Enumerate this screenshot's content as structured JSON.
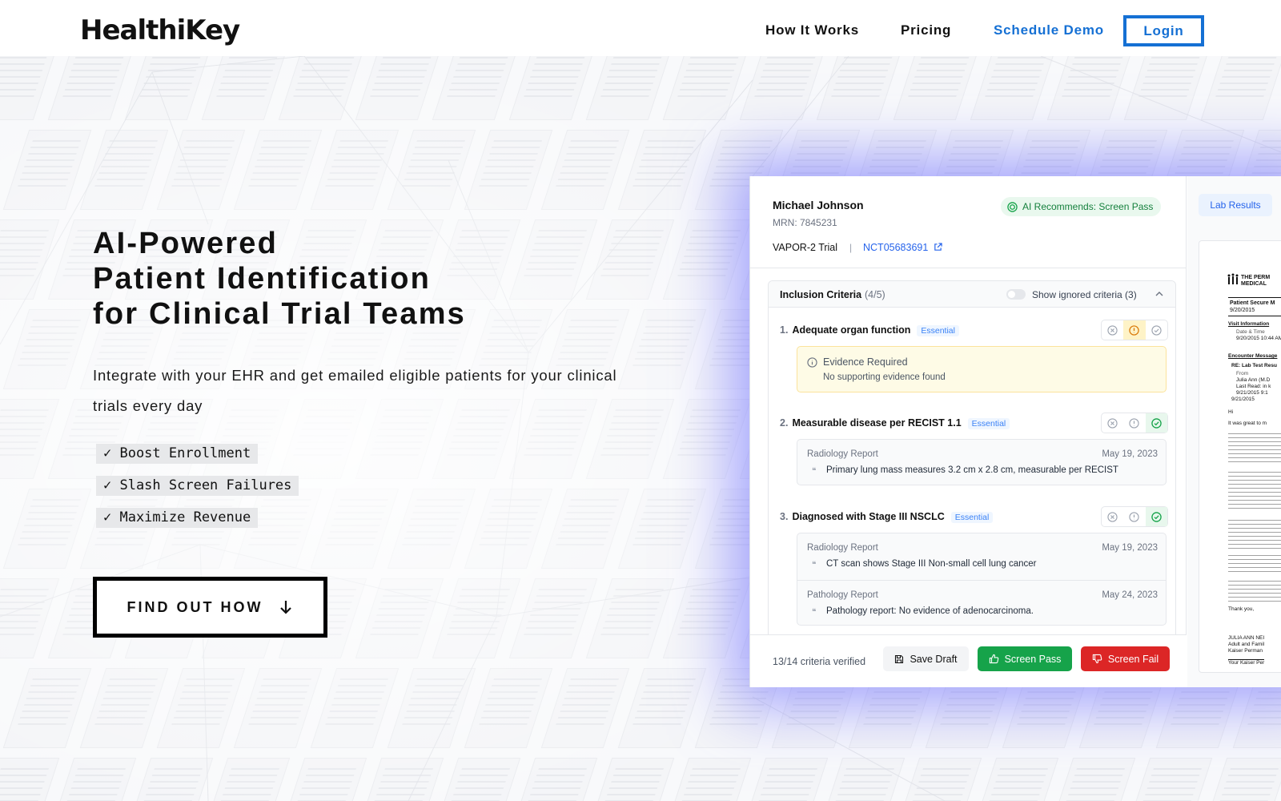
{
  "brand": {
    "logo": "HealthiKey"
  },
  "nav": {
    "how_it_works": "How It Works",
    "pricing": "Pricing",
    "schedule_demo": "Schedule Demo",
    "login": "Login"
  },
  "hero": {
    "title_lines": [
      "AI-Powered",
      "Patient Identification",
      "for Clinical Trial Teams"
    ],
    "subtitle": "Integrate with your EHR and get emailed eligible patients for your clinical trials every day",
    "checks": [
      "✓ Boost Enrollment",
      "✓ Slash Screen Failures",
      "✓ Maximize Revenue"
    ],
    "cta": "FIND OUT HOW"
  },
  "panel": {
    "patient_name": "Michael Johnson",
    "mrn": "MRN: 7845231",
    "trial": "VAPOR-2 Trial",
    "trial_sep": "|",
    "nct": "NCT05683691",
    "ai_badge": "AI Recommends: Screen Pass",
    "criteria_title": "Inclusion Criteria",
    "criteria_count": "(4/5)",
    "show_ignored": "Show ignored criteria (3)",
    "essential": "Essential",
    "items": [
      {
        "num": "1.",
        "title": "Adequate organ function",
        "status": "warning"
      },
      {
        "num": "2.",
        "title": "Measurable disease per RECIST 1.1",
        "status": "pass"
      },
      {
        "num": "3.",
        "title": "Diagnosed with Stage III NSCLC",
        "status": "pass"
      }
    ],
    "evidence_required": {
      "title": "Evidence Required",
      "sub": "No supporting evidence found"
    },
    "evidence_item2": [
      {
        "type": "Radiology Report",
        "date": "May 19, 2023",
        "quote": "Primary lung mass measures 3.2 cm x 2.8 cm, measurable per RECIST"
      }
    ],
    "evidence_item3": [
      {
        "type": "Radiology Report",
        "date": "May 19, 2023",
        "quote": "CT scan shows Stage III Non-small cell lung cancer"
      },
      {
        "type": "Pathology Report",
        "date": "May 24, 2023",
        "quote": "Pathology report: No evidence of adenocarcinoma."
      }
    ],
    "verified": "13/14 criteria verified",
    "save_draft": "Save Draft",
    "screen_pass": "Screen Pass",
    "screen_fail": "Screen Fail",
    "lab_results": "Lab Results",
    "doc": {
      "org_line1": "THE PERM",
      "org_line2": "MEDICAL",
      "secure_line1": "Patient Secure M",
      "secure_line2": "9/20/2015",
      "visit_info": "Visit Information",
      "date_time": "Date & Time",
      "date_val": "9/20/2015 10:44 AM",
      "encounter": "Encounter Message",
      "re": "RE: Lab Test Resu",
      "from": "From",
      "from_val1": "Julia Ann (M.D",
      "from_val2": "Last Read: in k",
      "from_val3": "9/21/2015  9:1",
      "from_val4": "9/21/2015",
      "hi": "Hi",
      "p1": "It was great to m",
      "thanks": "Thank you,",
      "sig1": "JULIA ANN NEI",
      "sig2": "Adult and Famil",
      "sig3": "Kaiser Perman",
      "sig4": "Your Kaiser Per"
    },
    "colors": {
      "accent": "#1570d4",
      "pass": "#16a34a",
      "fail": "#dc2626",
      "glow": "#5f5fff"
    }
  }
}
